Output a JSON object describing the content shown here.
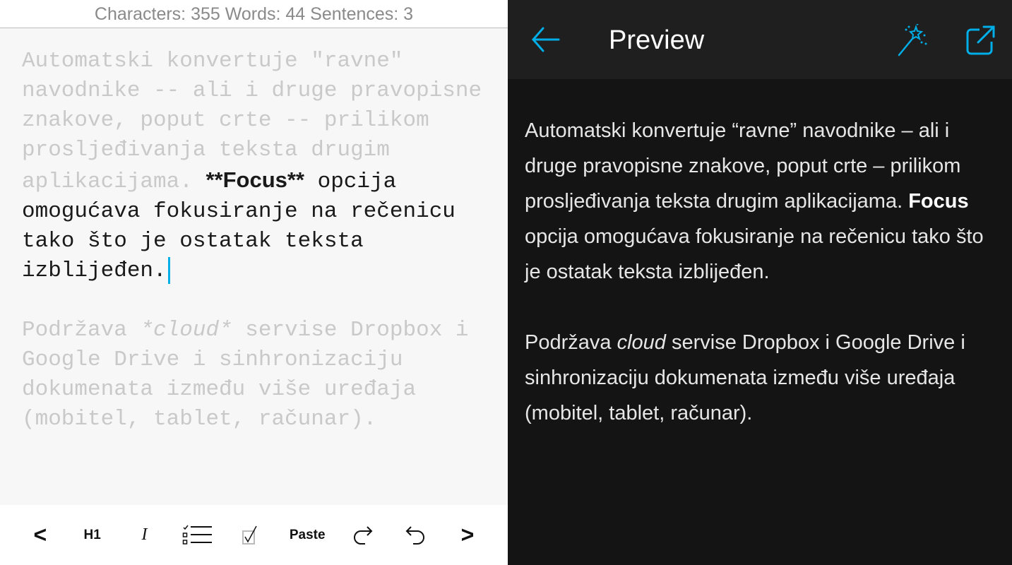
{
  "status": {
    "text": "Characters: 355 Words: 44 Sentences: 3"
  },
  "editor": {
    "p1_faded": "Automatski konvertuje \"ravne\" navodnike -- ali i druge pravopisne znakove, poput crte -- prilikom prosljeđivanja teksta drugim aplikacijama. ",
    "p1_bold": "**Focus**",
    "p1_focus": " opcija omogućava fokusiranje na rečenicu tako što je ostatak teksta izblijeđen.",
    "p2_a": "Podržava ",
    "p2_ital": "*cloud*",
    "p2_b": " servise Dropbox i Google Drive i sinhronizaciju dokumenata između više uređaja (mobitel, tablet, računar)."
  },
  "toolbar": {
    "prev": "<",
    "h1": "H1",
    "italic": "I",
    "paste": "Paste",
    "next": ">"
  },
  "preview": {
    "title": "Preview",
    "p1_a": "Automatski konvertuje “ravne” navodnike – ali i druge pravopisne znakove, poput crte – prilikom prosljeđivanja teksta drugim aplikacijama. ",
    "p1_bold": "Focus",
    "p1_b": " opcija omogućava fokusiranje na rečenicu tako što je ostatak teksta izblijeđen.",
    "p2_a": "Podržava ",
    "p2_ital": "cloud",
    "p2_b": " servise Dropbox i Google Drive i sinhronizaciju dokumenata između više uređaja (mobitel, tablet, računar)."
  },
  "colors": {
    "accent": "#00aee8"
  }
}
